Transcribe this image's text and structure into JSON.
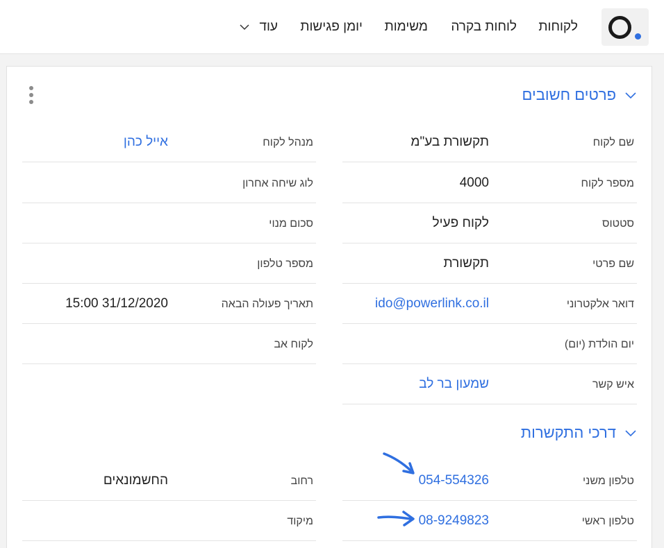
{
  "nav": {
    "items": [
      "לקוחות",
      "לוחות בקרה",
      "משימות",
      "יומן פגישות",
      "עוד"
    ]
  },
  "sections": {
    "important": {
      "title": "פרטים חשובים"
    },
    "contact": {
      "title": "דרכי התקשרות"
    }
  },
  "fields": {
    "customer_name": {
      "label": "שם לקוח",
      "value": "תקשורת בע\"מ"
    },
    "customer_number": {
      "label": "מספר לקוח",
      "value": "4000"
    },
    "status": {
      "label": "סטטוס",
      "value": "לקוח פעיל"
    },
    "first_name": {
      "label": "שם פרטי",
      "value": "תקשורת"
    },
    "email": {
      "label": "דואר אלקטרוני",
      "value": "ido@powerlink.co.il"
    },
    "birthday": {
      "label": "יום הולדת (יום)",
      "value": ""
    },
    "contact_person": {
      "label": "איש קשר",
      "value": "שמעון בר לב"
    },
    "account_manager": {
      "label": "מנהל לקוח",
      "value": "אייל כהן"
    },
    "last_call_log": {
      "label": "לוג שיחה אחרון",
      "value": ""
    },
    "subscription_amount": {
      "label": "סכום מנוי",
      "value": ""
    },
    "phone_number": {
      "label": "מספר טלפון",
      "value": ""
    },
    "next_action_date": {
      "label": "תאריך פעולה הבאה",
      "value": "15:00 31/12/2020"
    },
    "parent_customer": {
      "label": "לקוח אב",
      "value": ""
    },
    "secondary_phone": {
      "label": "טלפון משני",
      "value": "054-554326"
    },
    "primary_phone": {
      "label": "טלפון ראשי",
      "value": "08-9249823"
    },
    "street": {
      "label": "רחוב",
      "value": "החשמונאים"
    },
    "zip": {
      "label": "מיקוד",
      "value": ""
    }
  },
  "colors": {
    "accent": "#2f6fe0",
    "text": "#222222",
    "label": "#444444",
    "divider": "#e3e3e3"
  },
  "icons": [
    "logo-icon",
    "chevron-down-icon",
    "kebab-menu-icon",
    "arrow-icon"
  ]
}
